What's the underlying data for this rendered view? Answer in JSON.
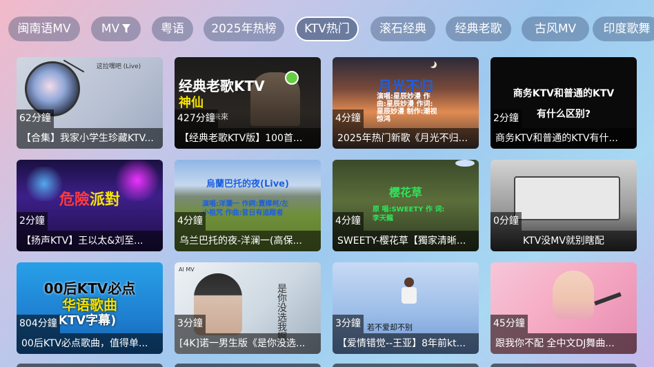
{
  "tabs": [
    {
      "label": "闽南语MV"
    },
    {
      "label": "MV",
      "icon": "filter-icon"
    },
    {
      "label": "粤语"
    },
    {
      "label": "2025年热榜"
    },
    {
      "label": "KTV热门",
      "active": true
    },
    {
      "label": "滚石经典"
    },
    {
      "label": "经典老歌"
    },
    {
      "label": "古风MV"
    },
    {
      "label": "印度歌舞"
    }
  ],
  "videos": [
    {
      "duration": "62分鐘",
      "title": "【合集】我家小学生珍藏KTV...",
      "thumb_text": "这拉嘿吧 (Live)"
    },
    {
      "duration": "427分鐘",
      "title": "【经典老歌KTV版】100首...",
      "thumb_text": "经典老歌KTV",
      "thumb_text2": "神仙",
      "thumb_text3": "未來"
    },
    {
      "duration": "4分鐘",
      "title": "2025年热门新歌《月光不归...",
      "thumb_text": "月光不归",
      "thumb_text2": "演唱:星辰妙漫 作曲:星辰妙漫 作词:星辰妙漫 制作:潮视惊鸿"
    },
    {
      "duration": "2分鐘",
      "title": "商务KTV和普通的KTV有什...",
      "thumb_text": "商务KTV和普通的KTV",
      "thumb_text2": "有什么区别?"
    },
    {
      "duration": "2分鐘",
      "title": "【扬声KTV】王以太&刘至...",
      "thumb_text": "危險派對"
    },
    {
      "duration": "4分鐘",
      "title": "乌兰巴托的夜-洋澜一(高保...",
      "thumb_text": "烏蘭巴托的夜(Live)",
      "thumb_text2": "演唱:洋瀾一 作詞:賈樟柯/左小祖咒 作曲:昔日有追蹤者"
    },
    {
      "duration": "4分鐘",
      "title": "SWEETY-樱花草【獨家清晰...",
      "thumb_text": "樱花草",
      "thumb_text2": "原 唱:SWEETY 作 词:李天龍"
    },
    {
      "duration": "0分鐘",
      "title": "KTV没MV就别瞎配",
      "center": true
    },
    {
      "duration": "804分鐘",
      "title": "00后KTV必点歌曲，值得单...",
      "thumb_text": "00后KTV必点",
      "thumb_text2": "华语歌曲",
      "thumb_text3": "KTV字幕)"
    },
    {
      "duration": "3分鐘",
      "title": "[4K]诺一男生版《是你没选...",
      "thumb_text": "是你没选我啊",
      "thumb_text2": "AI MV"
    },
    {
      "duration": "3分鐘",
      "title": "【爱情错觉--王亚】8年前kt...",
      "thumb_text": "若不爱却不别"
    },
    {
      "duration": "45分鐘",
      "title": "跟我你不配 全中文DJ舞曲..."
    }
  ],
  "colors": {
    "active_tab_border": "#ffffff",
    "pill_bg": "rgba(55,75,110,0.38)",
    "overlay": "rgba(0,0,0,0.55)",
    "highlight_yellow": "#f5e400",
    "highlight_green": "#2fe35a",
    "highlight_blue": "#1b5fe0"
  }
}
